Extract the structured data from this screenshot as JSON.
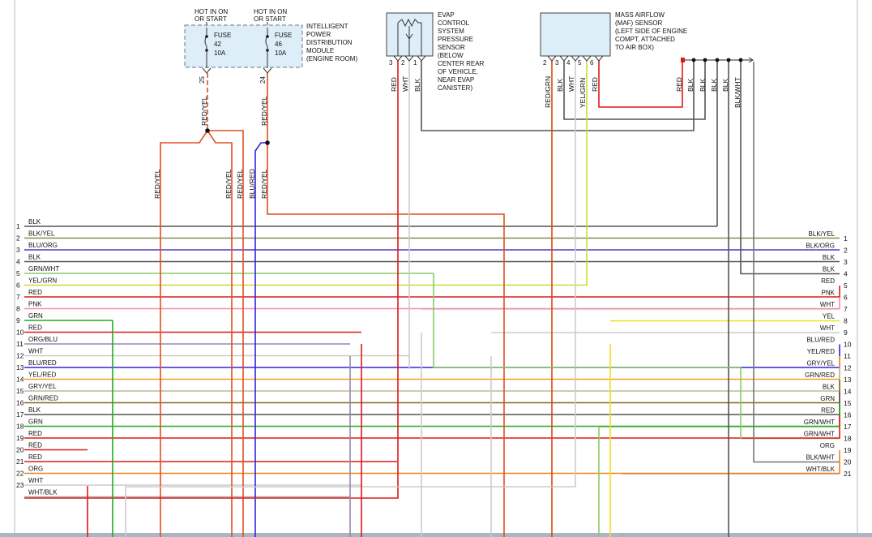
{
  "colors": {
    "BLK": "#555555",
    "BLK/YEL": "#888855",
    "BLU/ORG": "#5533cc",
    "GRN/WHT": "#88cc66",
    "YEL/GRN": "#ccdd33",
    "RED": "#e01818",
    "PNK": "#f090a8",
    "GRN": "#22aa22",
    "ORG/BLU": "#9988aa",
    "WHT": "#cccccc",
    "BLU/RED": "#3322dd",
    "YEL/RED": "#f0a020",
    "GRY/YEL": "#bbbb99",
    "GRN/RED": "#886622",
    "ORG": "#f08020",
    "WHT/BLK": "#aaaaaa",
    "RED/YEL": "#e05020",
    "BLK/WHT": "#777777",
    "RED/GRN": "#dd4411",
    "YEL": "#f0e020",
    "box_fill": "#ddeef8"
  },
  "fuse_module": {
    "hot_labels": [
      "HOT IN ON",
      "OR START",
      "HOT IN ON",
      "OR START"
    ],
    "fuses": [
      {
        "name": "FUSE",
        "number": "42",
        "rating": "10A",
        "pin": "25"
      },
      {
        "name": "FUSE",
        "number": "46",
        "rating": "10A",
        "pin": "24"
      }
    ],
    "module_label": [
      "INTELLIGENT",
      "POWER",
      "DISTRIBUTION",
      "MODULE",
      "(ENGINE ROOM)"
    ]
  },
  "evap_sensor": {
    "label": [
      "EVAP",
      "CONTROL",
      "SYSTEM",
      "PRESSURE",
      "SENSOR",
      "(BELOW",
      "CENTER REAR",
      "OF VEHICLE,",
      "NEAR EVAP",
      "CANISTER)"
    ],
    "pins": [
      "3",
      "2",
      "1"
    ],
    "wires": [
      "RED",
      "WHT",
      "BLK"
    ]
  },
  "maf_sensor": {
    "label": [
      "MASS AIRFLOW",
      "(MAF) SENSOR",
      "(LEFT SIDE OF ENGINE",
      "COMPT, ATTACHED",
      "TO AIR BOX)"
    ],
    "pins": [
      "2",
      "3",
      "4",
      "5",
      "6"
    ],
    "wires": [
      "RED/GRN",
      "BLK",
      "WHT",
      "YEL/GRN",
      "RED"
    ]
  },
  "vertical_wire_labels": [
    "RED/YEL",
    "RED/YEL",
    "RED/YEL",
    "RED/YEL",
    "RED/YEL",
    "BLU/RED",
    "RED/YEL",
    "RED",
    "BLK",
    "BLK",
    "BLK",
    "BLK",
    "BLK/WHT"
  ],
  "left_connector": [
    {
      "pin": "1",
      "wire": "BLK"
    },
    {
      "pin": "2",
      "wire": "BLK/YEL"
    },
    {
      "pin": "3",
      "wire": "BLU/ORG"
    },
    {
      "pin": "4",
      "wire": "BLK"
    },
    {
      "pin": "5",
      "wire": "GRN/WHT"
    },
    {
      "pin": "6",
      "wire": "YEL/GRN"
    },
    {
      "pin": "7",
      "wire": "RED"
    },
    {
      "pin": "8",
      "wire": "PNK"
    },
    {
      "pin": "9",
      "wire": "GRN"
    },
    {
      "pin": "10",
      "wire": "RED"
    },
    {
      "pin": "11",
      "wire": "ORG/BLU"
    },
    {
      "pin": "12",
      "wire": "WHT"
    },
    {
      "pin": "13",
      "wire": "BLU/RED"
    },
    {
      "pin": "14",
      "wire": "YEL/RED"
    },
    {
      "pin": "15",
      "wire": "GRY/YEL"
    },
    {
      "pin": "16",
      "wire": "GRN/RED"
    },
    {
      "pin": "17",
      "wire": "BLK"
    },
    {
      "pin": "18",
      "wire": "GRN"
    },
    {
      "pin": "19",
      "wire": "RED"
    },
    {
      "pin": "20",
      "wire": "RED"
    },
    {
      "pin": "21",
      "wire": "RED"
    },
    {
      "pin": "22",
      "wire": "ORG"
    },
    {
      "pin": "23",
      "wire": "WHT"
    },
    {
      "pin": "",
      "wire": "WHT/BLK"
    }
  ],
  "right_connector": [
    {
      "pin": "1",
      "wire": "BLK/YEL"
    },
    {
      "pin": "2",
      "wire": "BLK/ORG"
    },
    {
      "pin": "3",
      "wire": "BLK"
    },
    {
      "pin": "4",
      "wire": "BLK"
    },
    {
      "pin": "5",
      "wire": "RED"
    },
    {
      "pin": "6",
      "wire": "PNK"
    },
    {
      "pin": "7",
      "wire": "WHT"
    },
    {
      "pin": "8",
      "wire": "YEL"
    },
    {
      "pin": "9",
      "wire": "WHT"
    },
    {
      "pin": "10",
      "wire": "BLU/RED"
    },
    {
      "pin": "11",
      "wire": "YEL/RED"
    },
    {
      "pin": "12",
      "wire": "GRY/YEL"
    },
    {
      "pin": "13",
      "wire": "GRN/RED"
    },
    {
      "pin": "14",
      "wire": "BLK"
    },
    {
      "pin": "15",
      "wire": "GRN"
    },
    {
      "pin": "16",
      "wire": "RED"
    },
    {
      "pin": "17",
      "wire": "GRN/WHT"
    },
    {
      "pin": "18",
      "wire": "GRN/WHT"
    },
    {
      "pin": "19",
      "wire": "ORG"
    },
    {
      "pin": "20",
      "wire": "BLK/WHT"
    },
    {
      "pin": "21",
      "wire": "WHT/BLK"
    }
  ]
}
